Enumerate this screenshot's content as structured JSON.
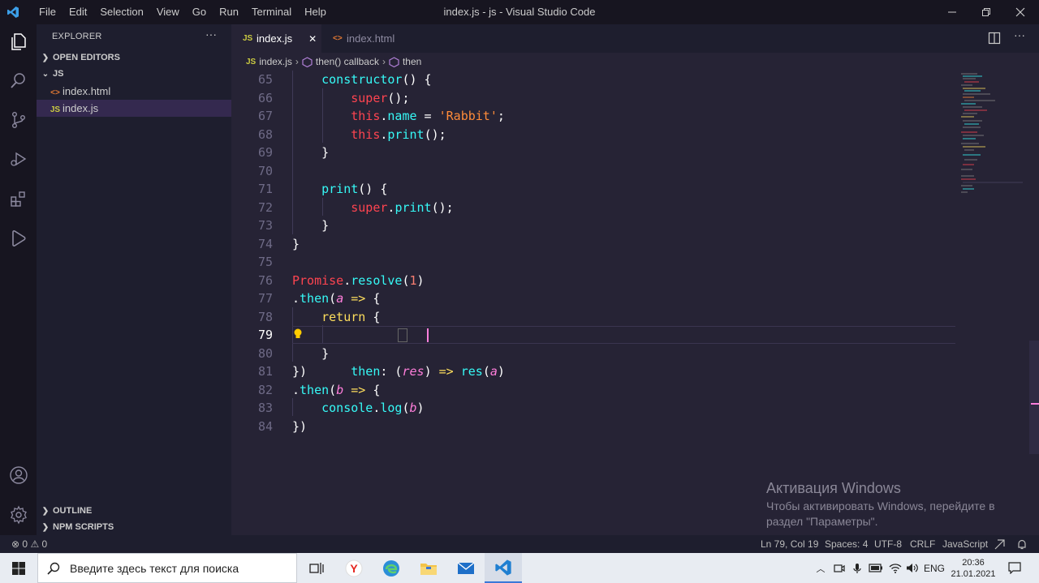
{
  "titlebar": {
    "menu": [
      "File",
      "Edit",
      "Selection",
      "View",
      "Go",
      "Run",
      "Terminal",
      "Help"
    ],
    "title": "index.js - js - Visual Studio Code"
  },
  "explorer": {
    "title": "EXPLORER",
    "more": "···",
    "open_editors": "OPEN EDITORS",
    "folder": "JS",
    "files": [
      {
        "icon": "<>",
        "name": "index.html"
      },
      {
        "icon": "JS",
        "name": "index.js"
      }
    ],
    "outline": "OUTLINE",
    "npm_scripts": "NPM SCRIPTS"
  },
  "tabs": [
    {
      "icon": "JS",
      "label": "index.js",
      "close": "✕"
    },
    {
      "icon": "<>",
      "label": "index.html"
    }
  ],
  "breadcrumb": {
    "file_icon": "JS",
    "file": "index.js",
    "sep": "›",
    "item1": "then() callback",
    "item2": "then"
  },
  "editor": {
    "current_line": 79,
    "line_numbers": [
      "65",
      "66",
      "67",
      "68",
      "69",
      "70",
      "71",
      "72",
      "73",
      "74",
      "75",
      "76",
      "77",
      "78",
      "79",
      "80",
      "81",
      "82",
      "83",
      "84"
    ],
    "lines": {
      "l65": [
        "    ",
        "constructor",
        "() {"
      ],
      "l66": [
        "        ",
        "super",
        "();"
      ],
      "l67": [
        "        ",
        "this",
        ".",
        "name",
        " = ",
        "'Rabbit'",
        ";"
      ],
      "l68": [
        "        ",
        "this",
        ".",
        "print",
        "();"
      ],
      "l69": [
        "    }"
      ],
      "l71": [
        "    ",
        "print",
        "() {"
      ],
      "l72": [
        "        ",
        "super",
        ".",
        "print",
        "();"
      ],
      "l73": [
        "    }"
      ],
      "l74": [
        "}"
      ],
      "l76": [
        "Promise",
        ".",
        "resolve",
        "(",
        "1",
        ")"
      ],
      "l77": [
        ".",
        "then",
        "(",
        "a",
        " ",
        "=>",
        " {"
      ],
      "l78": [
        "    ",
        "return",
        " {"
      ],
      "l79": [
        "        ",
        "then",
        ": (",
        "res",
        ") ",
        "=>",
        " ",
        "res",
        "(",
        "a",
        ")"
      ],
      "l80": [
        "    }"
      ],
      "l81": [
        "})"
      ],
      "l82": [
        ".",
        "then",
        "(",
        "b",
        " ",
        "=>",
        " {"
      ],
      "l83": [
        "    ",
        "console",
        ".",
        "log",
        "(",
        "b",
        ")"
      ],
      "l84": [
        "})"
      ]
    }
  },
  "watermark": {
    "title": "Активация Windows",
    "line1": "Чтобы активировать Windows, перейдите в",
    "line2": "раздел \"Параметры\"."
  },
  "statusbar": {
    "errors": "0",
    "warnings": "0",
    "position": "Ln 79, Col 19",
    "spaces": "Spaces: 4",
    "encoding": "UTF-8",
    "eol": "CRLF",
    "language": "JavaScript"
  },
  "taskbar": {
    "search_placeholder": "Введите здесь текст для поиска",
    "lang": "ENG",
    "time": "20:36",
    "date": "21.01.2021"
  },
  "colors": {
    "accent": "#36f9f6",
    "keyword": "#fede5d",
    "class": "#fe4450",
    "param": "#ff7edb",
    "string": "#ff8b39"
  }
}
